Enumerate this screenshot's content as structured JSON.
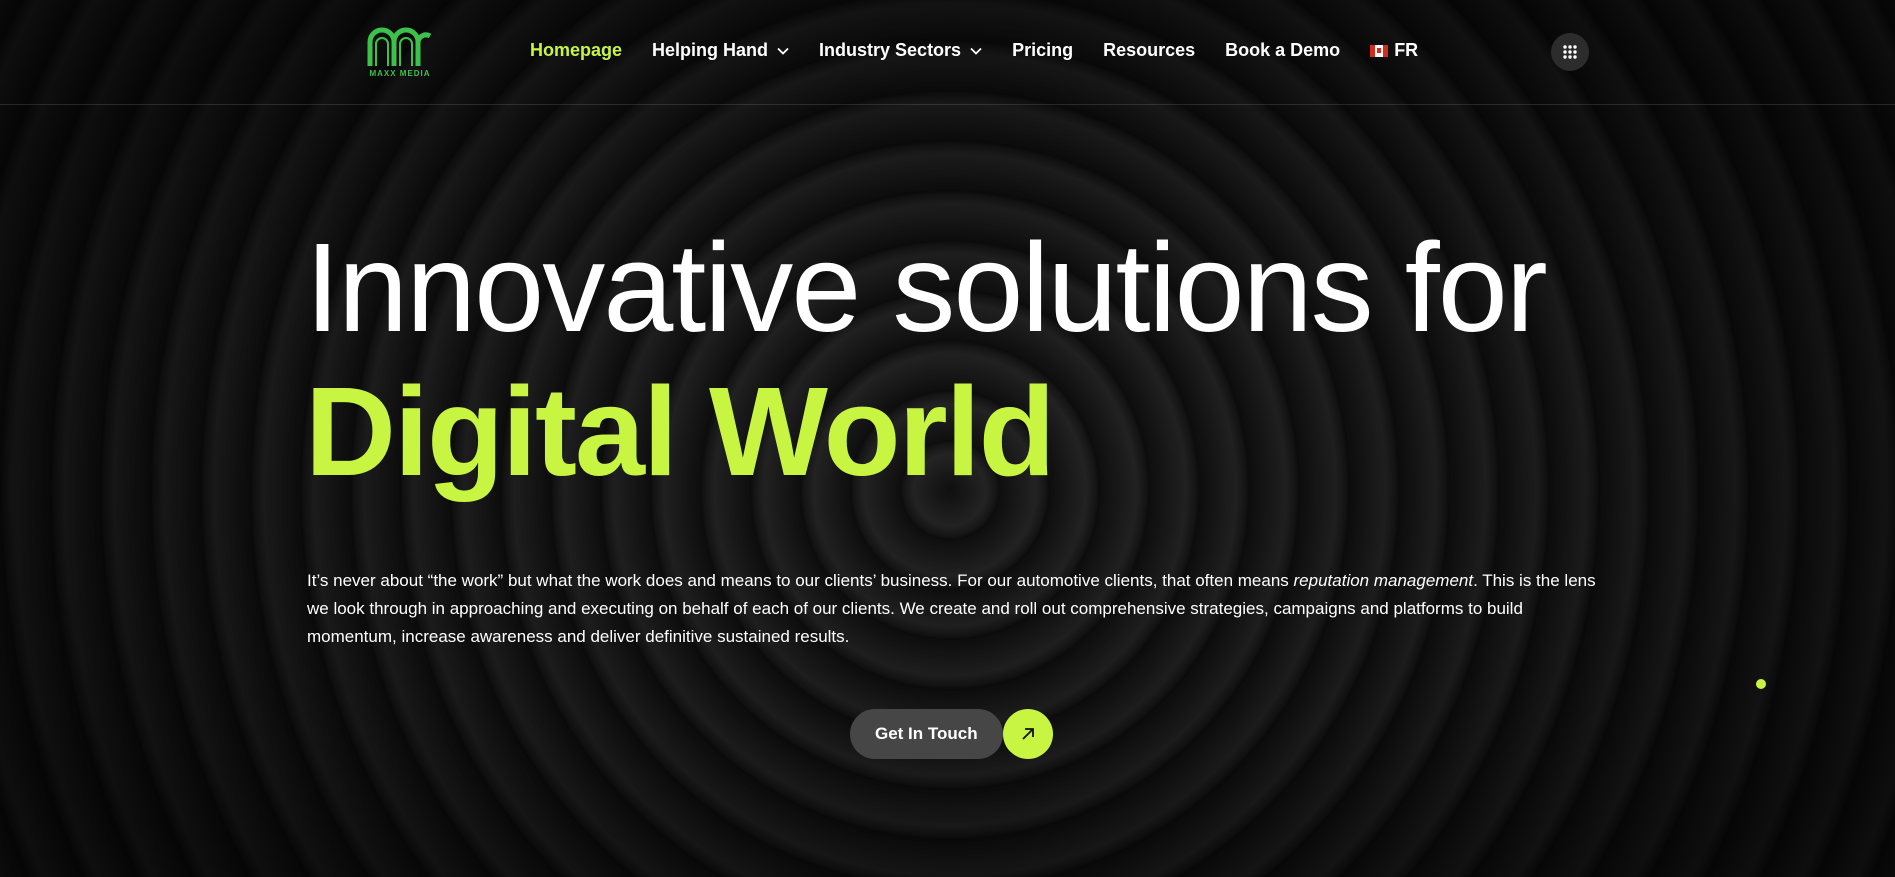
{
  "header": {
    "logo_text": "MAXX MEDIA",
    "nav": [
      {
        "label": "Homepage",
        "active": true,
        "dropdown": false
      },
      {
        "label": "Helping Hand",
        "active": false,
        "dropdown": true
      },
      {
        "label": "Industry Sectors",
        "active": false,
        "dropdown": true
      },
      {
        "label": "Pricing",
        "active": false,
        "dropdown": false
      },
      {
        "label": "Resources",
        "active": false,
        "dropdown": false
      },
      {
        "label": "Book a Demo",
        "active": false,
        "dropdown": false
      }
    ],
    "language": "FR",
    "menu_icon": "grid-icon"
  },
  "hero": {
    "line1": "Innovative solutions for",
    "line2": "Digital World",
    "desc_before": "It’s never about “the work” but what the work does and means to our clients’ business. For our automotive clients, that often means ",
    "desc_emphasis": "reputation management",
    "desc_after": ". This is the lens we look through in approaching and executing on behalf of each of our clients. We create and roll out comprehensive strategies, campaigns and platforms to build momentum, increase awareness and deliver definitive sustained results.",
    "cta_label": "Get In Touch"
  },
  "colors": {
    "accent": "#c8f542",
    "logo_green": "#3cc24a",
    "background": "#141414",
    "button_bg": "#464646"
  }
}
